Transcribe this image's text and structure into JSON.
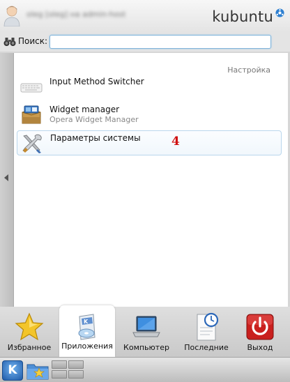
{
  "header": {
    "user_line": "oleg [oleg] на admin-host",
    "brand": "kubuntu",
    "brand_icon": "kubuntu-logo-icon",
    "avatar_icon": "user-avatar-icon"
  },
  "search": {
    "label": "Поиск:",
    "value": "",
    "placeholder": "",
    "icon": "binoculars-icon"
  },
  "results": {
    "section": "Настройка",
    "items": [
      {
        "title": "Input Method Switcher",
        "subtitle": "",
        "icon": "keyboard-icon"
      },
      {
        "title": "Widget manager",
        "subtitle": "Opera Widget Manager",
        "icon": "widget-box-icon"
      },
      {
        "title": "Параметры системы",
        "subtitle": "",
        "icon": "tools-icon",
        "selected": true
      }
    ]
  },
  "annotation": "4",
  "tabs": [
    {
      "label": "Избранное",
      "icon": "star-icon"
    },
    {
      "label": "Приложения",
      "icon": "applications-icon",
      "active": true
    },
    {
      "label": "Компьютер",
      "icon": "laptop-icon"
    },
    {
      "label": "Последние",
      "icon": "recent-clock-icon"
    },
    {
      "label": "Выход",
      "icon": "power-icon"
    }
  ],
  "taskbar": {
    "launcher_letter": "K",
    "items": [
      "kde-menu-icon",
      "folder-star-icon",
      "pager"
    ]
  },
  "colors": {
    "accent": "#7fb3d9",
    "annotation": "#d01010",
    "exit": "#c9201e"
  }
}
